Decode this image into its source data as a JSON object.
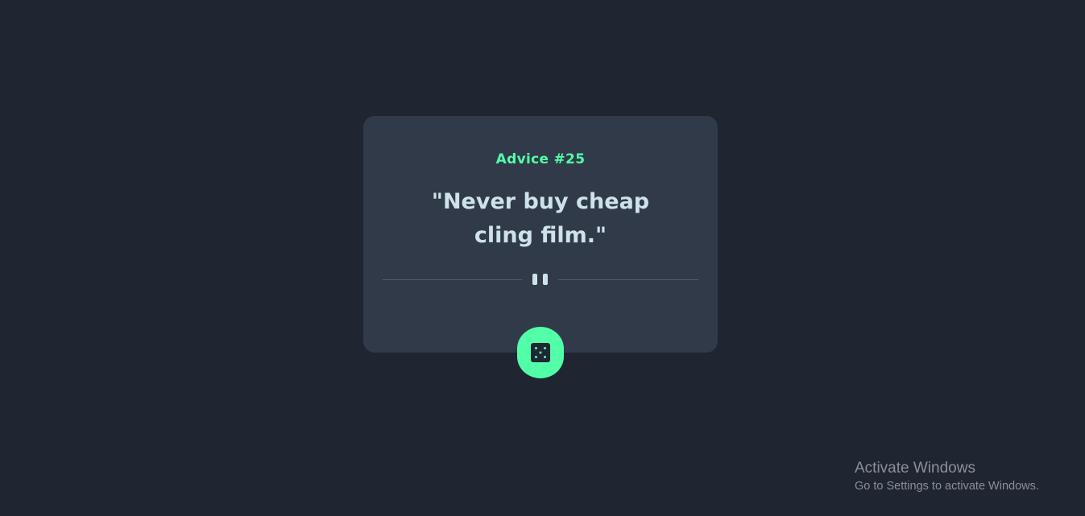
{
  "card": {
    "advice_id": "Advice #25",
    "advice_text": "\"Never buy cheap cling film.\"",
    "divider_icon": "pause-icon"
  },
  "dice_button": {
    "icon": "dice-icon",
    "color": "#52ffa8"
  },
  "watermark": {
    "title": "Activate Windows",
    "subtitle": "Go to Settings to activate Windows."
  },
  "colors": {
    "background": "#1f2531",
    "card": "#313a49",
    "accent": "#52ffa8",
    "text": "#cee3e9"
  }
}
